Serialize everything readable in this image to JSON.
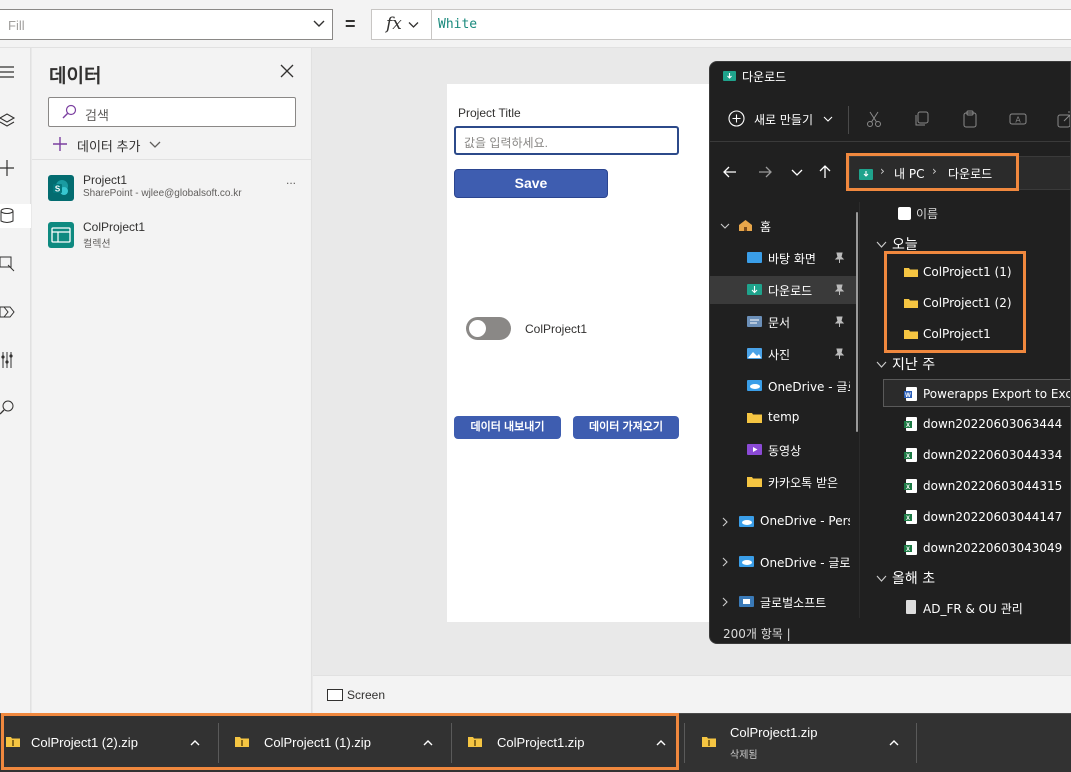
{
  "formula_bar": {
    "property": "Fill",
    "equals": "=",
    "fx": "fx",
    "formula": "White"
  },
  "data_pane": {
    "title": "데이터",
    "search_placeholder": "검색",
    "add_data_label": "데이터 추가",
    "sources": [
      {
        "name": "Project1",
        "subtitle": "SharePoint - wjlee@globalsoft.co.kr",
        "more": "...",
        "icon": "sharepoint-icon"
      },
      {
        "name": "ColProject1",
        "subtitle": "컬렉션",
        "icon": "collection-icon"
      }
    ]
  },
  "canvas": {
    "label_title": "Project Title",
    "input_placeholder": "값을 입력하세요.",
    "save_button": "Save",
    "toggle_label": "ColProject1",
    "toggle_on": false,
    "export_button": "데이터 내보내기",
    "import_button": "데이터 가져오기"
  },
  "screens_strip": {
    "label": "Screen"
  },
  "explorer": {
    "title": "다운로드",
    "new_button": "새로 만들기",
    "address": [
      "내 PC",
      "다운로드"
    ],
    "address_separator": "›",
    "nav_items": [
      {
        "label": "홈",
        "icon": "home-icon",
        "expandable": true
      },
      {
        "label": "바탕 화면",
        "icon": "desktop-icon",
        "pinned": true
      },
      {
        "label": "다운로드",
        "icon": "download-folder-icon",
        "pinned": true,
        "selected": true
      },
      {
        "label": "문서",
        "icon": "documents-icon",
        "pinned": true
      },
      {
        "label": "사진",
        "icon": "pictures-icon",
        "pinned": true
      },
      {
        "label": "OneDrive - 글로",
        "icon": "onedrive-icon"
      },
      {
        "label": "temp",
        "icon": "folder-icon"
      },
      {
        "label": "동영상",
        "icon": "videos-icon"
      },
      {
        "label": "카카오톡 받은",
        "icon": "folder-icon"
      },
      {
        "label": "OneDrive - Perso",
        "icon": "onedrive-icon",
        "expandable": true
      },
      {
        "label": "OneDrive - 글로",
        "icon": "onedrive-icon",
        "expandable": true
      },
      {
        "label": "글로벌소프트",
        "icon": "network-folder-icon",
        "expandable": true
      }
    ],
    "column_header": "이름",
    "groups": [
      {
        "label": "오늘",
        "files": [
          {
            "name": "ColProject1 (1)",
            "icon": "folder-icon"
          },
          {
            "name": "ColProject1 (2)",
            "icon": "folder-icon"
          },
          {
            "name": "ColProject1",
            "icon": "folder-icon"
          }
        ]
      },
      {
        "label": "지난 주",
        "files": [
          {
            "name": "Powerapps Export to Excel",
            "icon": "word-icon",
            "selected": true
          },
          {
            "name": "down20220603063444",
            "icon": "excel-icon"
          },
          {
            "name": "down20220603044334",
            "icon": "excel-icon"
          },
          {
            "name": "down20220603044315",
            "icon": "excel-icon"
          },
          {
            "name": "down20220603044147",
            "icon": "excel-icon"
          },
          {
            "name": "down20220603043049",
            "icon": "excel-icon"
          }
        ]
      },
      {
        "label": "올해 초",
        "files": [
          {
            "name": "AD_FR & OU 관리",
            "icon": "file-icon"
          }
        ]
      }
    ],
    "status": "200개 항목  |"
  },
  "downloads": [
    {
      "name": "ColProject1 (2).zip"
    },
    {
      "name": "ColProject1 (1).zip"
    },
    {
      "name": "ColProject1.zip"
    },
    {
      "name": "ColProject1.zip",
      "status": "삭제됨"
    }
  ],
  "colors": {
    "highlight": "#f0883e",
    "button_blue": "#3e5db0",
    "explorer_bg": "#202020",
    "download_bar_bg": "#323232",
    "formula_text": "#1a8a7d"
  }
}
